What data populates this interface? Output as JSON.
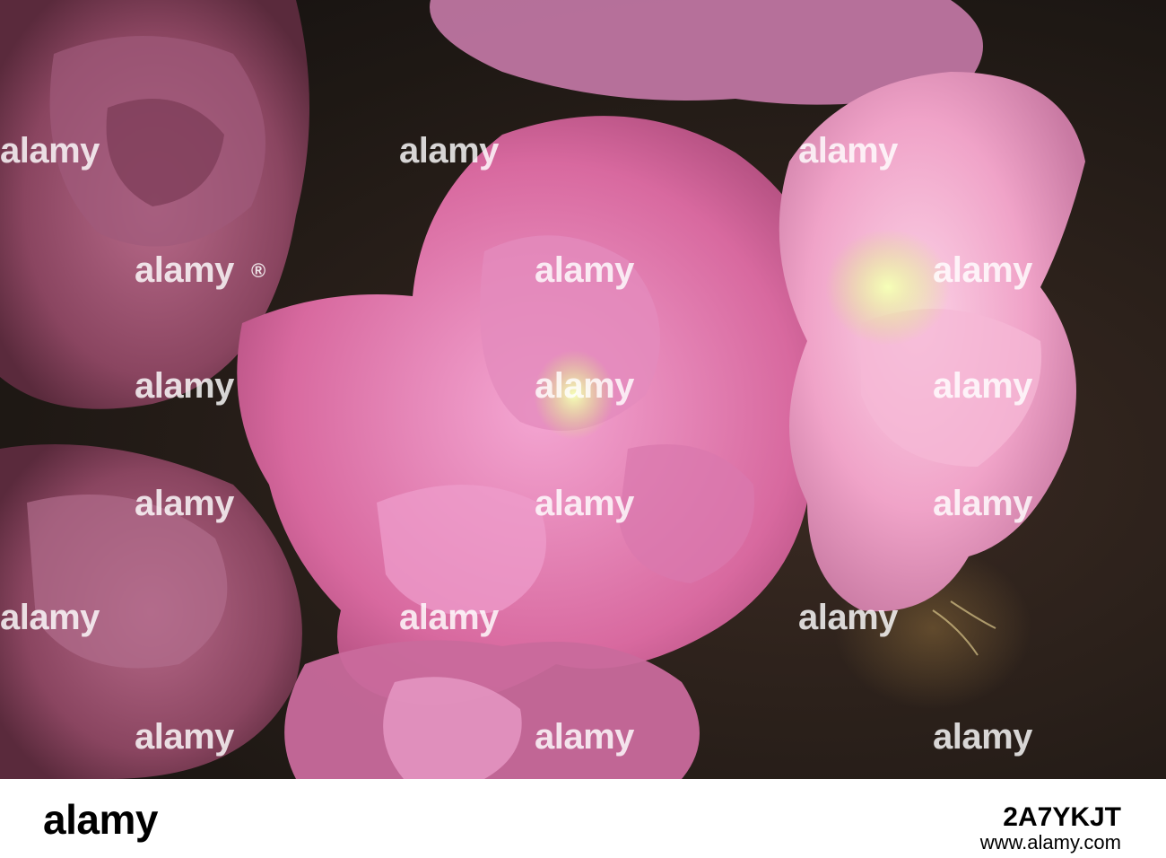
{
  "watermark": {
    "brand": "alamy",
    "dot": "®"
  },
  "footer": {
    "logo": "alamy",
    "image_id": "2A7YKJT",
    "url": "www.alamy.com"
  },
  "colors": {
    "background_dark": "#1e1814",
    "flower_pink": "#e07ab8",
    "flower_light_pink": "#f2a8cf",
    "flower_dried": "#8e4a62",
    "flower_center": "#e8f2a0",
    "bokeh": "#7a5a30"
  }
}
